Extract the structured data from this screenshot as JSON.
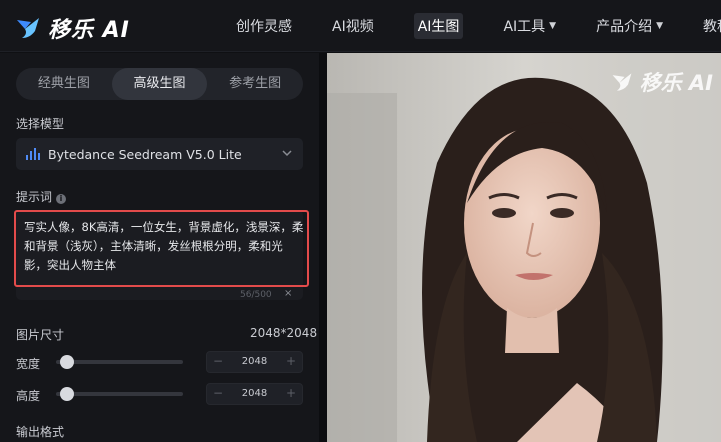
{
  "brand": {
    "name": "移乐 AI"
  },
  "nav": {
    "items": [
      {
        "label": "创作灵感",
        "dropdown": false
      },
      {
        "label": "AI视频",
        "dropdown": false
      },
      {
        "label": "AI生图",
        "dropdown": false,
        "active": true
      },
      {
        "label": "AI工具",
        "dropdown": true
      },
      {
        "label": "产品介绍",
        "dropdown": true
      },
      {
        "label": "教程&知",
        "dropdown": false
      }
    ]
  },
  "tabs": [
    {
      "label": "经典生图",
      "active": false
    },
    {
      "label": "高级生图",
      "active": true
    },
    {
      "label": "参考生图",
      "active": false
    }
  ],
  "model": {
    "label": "选择模型",
    "selected": "Bytedance Seedream V5.0 Lite",
    "icon": "bars-icon"
  },
  "prompt": {
    "label": "提示词",
    "text": "写实人像，8K高清，一位女生，背景虚化，浅景深，柔和背景（浅灰），主体清晰，发丝根根分明，柔和光影，突出人物主体",
    "counter": "56/500",
    "clear": "×"
  },
  "size": {
    "label": "图片尺寸",
    "value": "2048*2048",
    "width_label": "宽度",
    "width_value": "2048",
    "height_label": "高度",
    "height_value": "2048",
    "width_fraction": 0.03,
    "height_fraction": 0.03
  },
  "output": {
    "label": "输出格式"
  },
  "preview": {
    "watermark": "移乐 AI"
  },
  "colors": {
    "accent": "#4f8bf5",
    "highlight": "#e34b4b",
    "panel": "#15161a"
  }
}
